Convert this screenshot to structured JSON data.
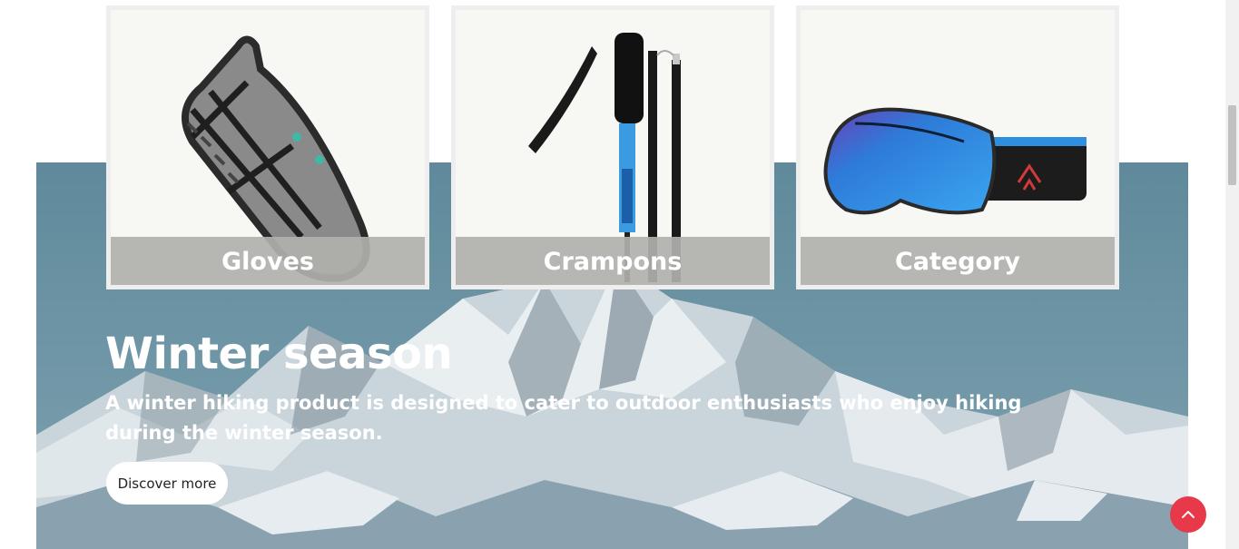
{
  "categories": [
    {
      "label": "Gloves",
      "icon": "crampon-boot-image"
    },
    {
      "label": "Crampons",
      "icon": "trekking-poles-image"
    },
    {
      "label": "Category",
      "icon": "ski-goggles-image"
    }
  ],
  "hero": {
    "title": "Winter season",
    "description": "A winter hiking product is designed to cater to outdoor enthusiasts who enjoy hiking during the winter season.",
    "button_label": "Discover more"
  },
  "back_to_top": {
    "icon": "chevron-up-icon",
    "color": "#e8394a"
  },
  "colors": {
    "hero_overlay": "#6a8fa0",
    "card_label_bg": "#b0b0ac"
  }
}
